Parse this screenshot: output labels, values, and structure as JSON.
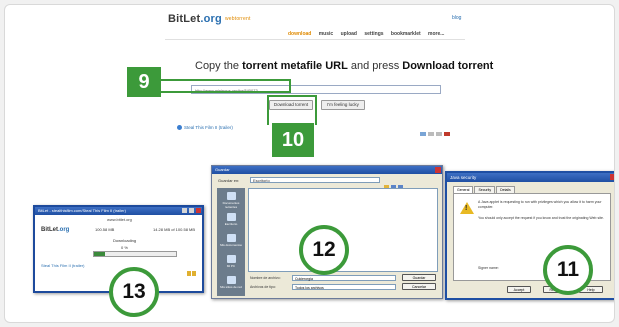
{
  "site": {
    "logo_main": "BitLet",
    "logo_tld": ".org",
    "logo_sub": "webtorrent",
    "blog_link": "blog",
    "nav": [
      "download",
      "music",
      "upload",
      "settings",
      "bookmarklet",
      "more..."
    ],
    "instruction_prefix": "Copy the ",
    "instruction_bold1": "torrent metafile URL",
    "instruction_mid": " and press ",
    "instruction_bold2": "Download torrent",
    "url_value": "http://www.mininova.org/tor/840073",
    "download_button": "Download torrent",
    "lucky_button": "I'm feeling lucky",
    "steal_link": "Steal This Film II (trailer)"
  },
  "callouts": {
    "step9": "9",
    "step10": "10",
    "step11": "11",
    "step12": "12",
    "step13": "13"
  },
  "download_window": {
    "title": "BitLet - stealthisfilm.com/Steal This Film II (trailer)",
    "host": "www.bitlet.org",
    "logo_main": "BitLet",
    "logo_tld": ".org",
    "file_size": "100.58 MB",
    "rate": "14.28 MB of 100.58 MB",
    "status": "Downloading",
    "percent": "0 %",
    "progress": 0.14,
    "steal_link": "Steal This Film II (trailer)"
  },
  "save_dialog": {
    "title": "Guardar",
    "look_in_label": "Guardar en:",
    "look_in_value": "Escritorio",
    "places": [
      "Documentos recientes",
      "Escritorio",
      "Mis documentos",
      "Mi PC",
      "Mis sitios de red"
    ],
    "filename_label": "Nombre de archivo:",
    "filename_value": "Cukierorgia",
    "filetype_label": "Archivos de tipo:",
    "filetype_value": "Todos los archivos",
    "save_button": "Guardar",
    "cancel_button": "Cancelar"
  },
  "security_dialog": {
    "title": "Java security",
    "tabs": [
      "General",
      "Security",
      "Details"
    ],
    "message1": "A Java applet is requesting to run with privileges which you allow it to harm your computer.",
    "message2": "You should only accept the request if you know and trust the originating Web site.",
    "signer": "Signer name:",
    "accept_button": "Accept",
    "refuse_button": "Refuse",
    "help_button": "Help"
  },
  "colors": {
    "callout_green": "#3c9a3a",
    "link_blue": "#2a6fb0",
    "titlebar_blue": "#1f4fa3"
  }
}
